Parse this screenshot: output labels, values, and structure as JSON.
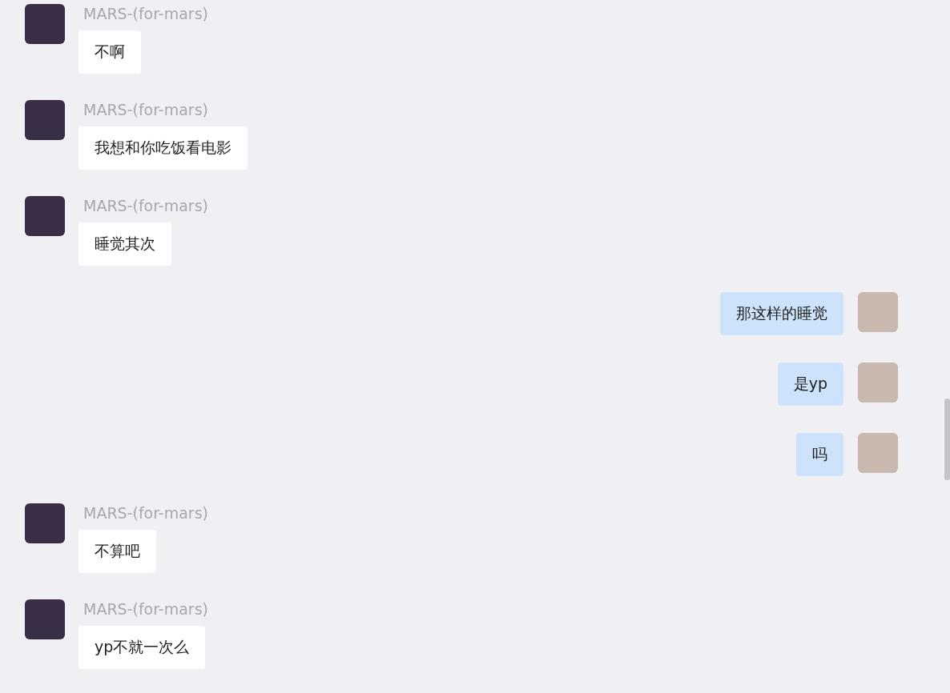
{
  "messages": [
    {
      "kind": "received",
      "name": "MARS-(for-mars)",
      "text": "不啊"
    },
    {
      "kind": "received",
      "name": "MARS-(for-mars)",
      "text": "我想和你吃饭看电影"
    },
    {
      "kind": "received",
      "name": "MARS-(for-mars)",
      "text": "睡觉其次"
    },
    {
      "kind": "sent",
      "text": "那这样的睡觉"
    },
    {
      "kind": "sent",
      "text": "是yp"
    },
    {
      "kind": "sent",
      "text": "吗"
    },
    {
      "kind": "received",
      "name": "MARS-(for-mars)",
      "text": "不算吧"
    },
    {
      "kind": "received",
      "name": "MARS-(for-mars)",
      "text": "yp不就一次么"
    }
  ]
}
